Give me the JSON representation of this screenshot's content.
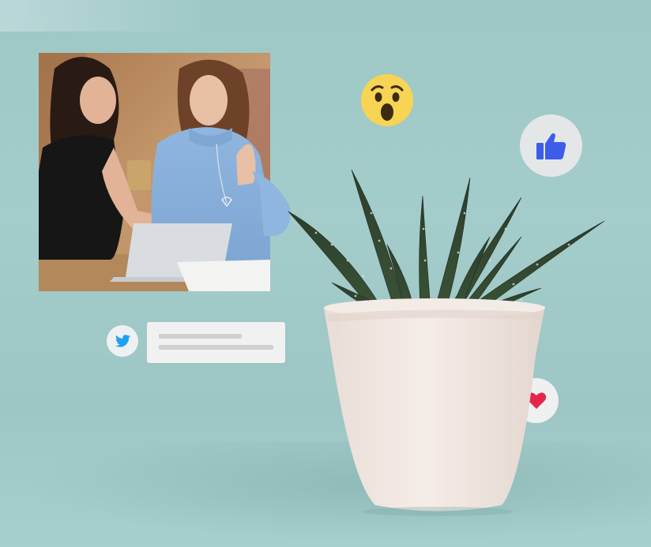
{
  "scene": {
    "background_color": "#9fc8c6",
    "elements": {
      "photo": {
        "subject": "two-women-with-laptop"
      },
      "wow_reaction": {
        "icon": "wow-emoji-icon",
        "color": "#f7d454"
      },
      "like_reaction": {
        "icon": "thumbs-up-icon",
        "color": "#3b5de7"
      },
      "heart_reaction": {
        "icon": "heart-icon",
        "color": "#e5264a"
      },
      "twitter": {
        "icon": "twitter-bird-icon",
        "color": "#1da1f2"
      },
      "tweet_placeholder": {
        "lines": 2
      },
      "plant": {
        "type": "succulent-in-white-pot"
      }
    }
  }
}
